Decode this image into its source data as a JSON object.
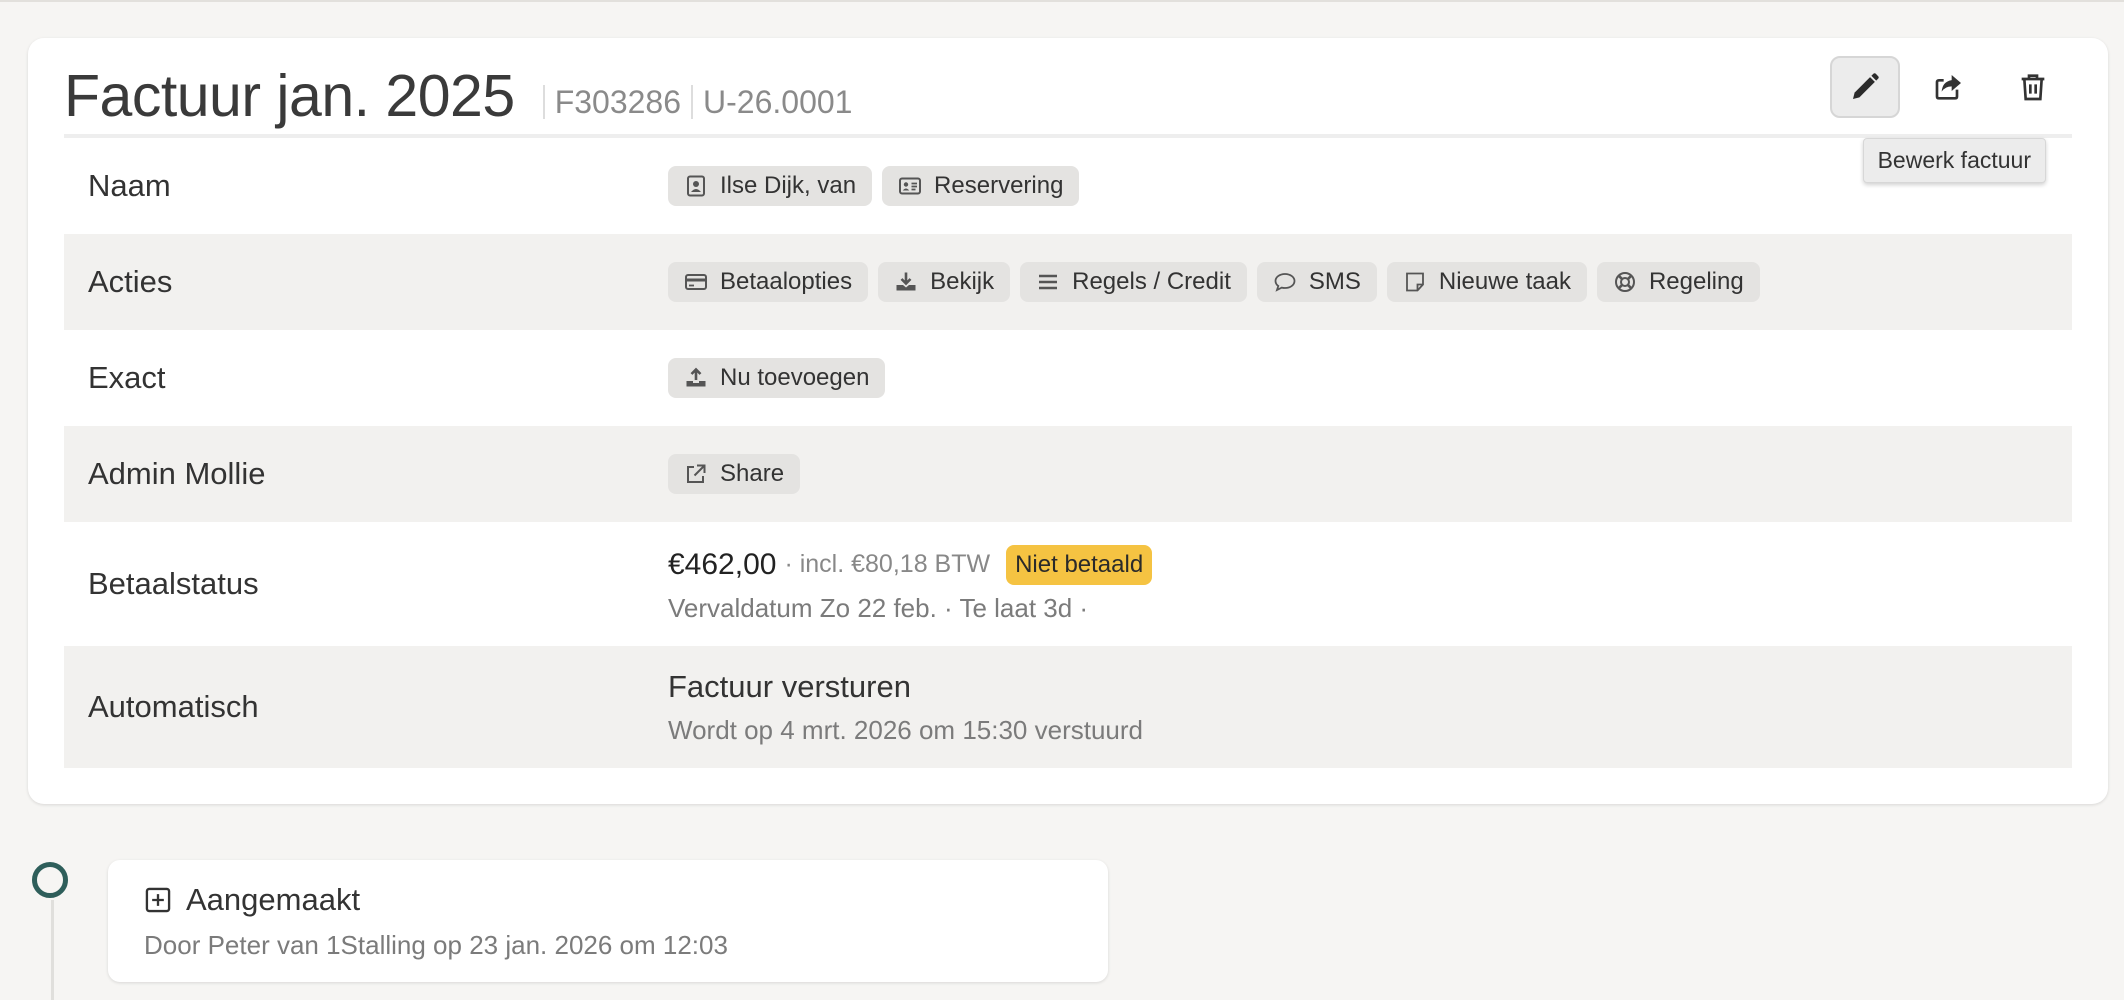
{
  "invoice": {
    "title": "Factuur jan. 2025",
    "number": "F303286",
    "reference": "U-26.0001"
  },
  "toolbar": {
    "edit_icon": "pencil-icon",
    "share_icon": "share-icon",
    "delete_icon": "trash-icon",
    "tooltip": "Bewerk factuur"
  },
  "rows": {
    "naam": {
      "label": "Naam",
      "contact": "Ilse Dijk, van",
      "reservation": "Reservering"
    },
    "acties": {
      "label": "Acties",
      "buttons": [
        "Betaalopties",
        "Bekijk",
        "Regels / Credit",
        "SMS",
        "Nieuwe taak",
        "Regeling"
      ]
    },
    "exact": {
      "label": "Exact",
      "button": "Nu toevoegen"
    },
    "mollie": {
      "label": "Admin Mollie",
      "button": "Share"
    },
    "betaalstatus": {
      "label": "Betaalstatus",
      "amount": "€462,00",
      "vat": "· incl. €80,18 BTW",
      "status": "Niet betaald",
      "due": "Vervaldatum Zo 22 feb. · Te laat 3d ·",
      "status_color": "#f5c342"
    },
    "automatisch": {
      "label": "Automatisch",
      "action": "Factuur versturen",
      "scheduled": "Wordt op 4 mrt. 2026 om 15:30 verstuurd"
    }
  },
  "timeline": {
    "events": [
      {
        "icon": "plus-square-icon",
        "title": "Aangemaakt",
        "detail": "Door Peter van 1Stalling op 23 jan. 2026 om 12:03"
      }
    ]
  },
  "colors": {
    "accent": "#2e5e5a",
    "badge": "#f5c342"
  }
}
